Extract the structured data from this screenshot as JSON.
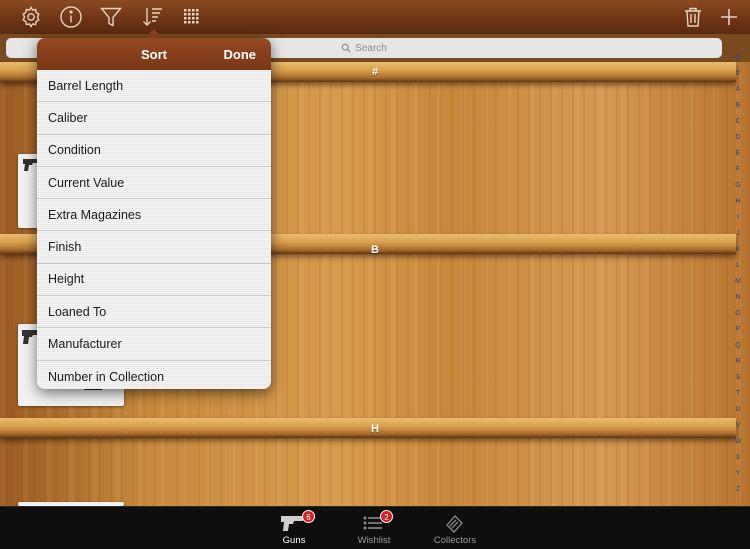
{
  "toolbar": {
    "icons": [
      "gear-icon",
      "info-icon",
      "filter-icon",
      "sort-icon",
      "grid-icon",
      "trash-icon",
      "plus-icon"
    ]
  },
  "search": {
    "placeholder": "Search"
  },
  "shelves": [
    {
      "label": "#"
    },
    {
      "label": "B"
    },
    {
      "label": "H"
    }
  ],
  "index_bar": [
    "Q",
    "#",
    "A",
    "B",
    "C",
    "D",
    "E",
    "F",
    "G",
    "H",
    "I",
    "J",
    "K",
    "L",
    "M",
    "N",
    "O",
    "P",
    "Q",
    "R",
    "S",
    "T",
    "U",
    "V",
    "W",
    "X",
    "Y",
    "Z"
  ],
  "sort_popover": {
    "title": "Sort",
    "done_label": "Done",
    "options": [
      "Barrel Length",
      "Caliber",
      "Condition",
      "Current Value",
      "Extra Magazines",
      "Finish",
      "Height",
      "Loaned To",
      "Manufacturer",
      "Number in Collection"
    ]
  },
  "tabbar": {
    "tabs": [
      {
        "label": "Guns",
        "badge": "6",
        "icon": "pistol-icon",
        "active": true
      },
      {
        "label": "Wishlist",
        "badge": "2",
        "icon": "list-icon",
        "active": false
      },
      {
        "label": "Collectors",
        "badge": "",
        "icon": "collectors-icon",
        "active": false
      }
    ]
  },
  "colors": {
    "toolbar_brown": "#7a3a18",
    "popover_header": "#8b4620",
    "badge_red": "#d32020",
    "index_blue": "#1a4c8c"
  }
}
